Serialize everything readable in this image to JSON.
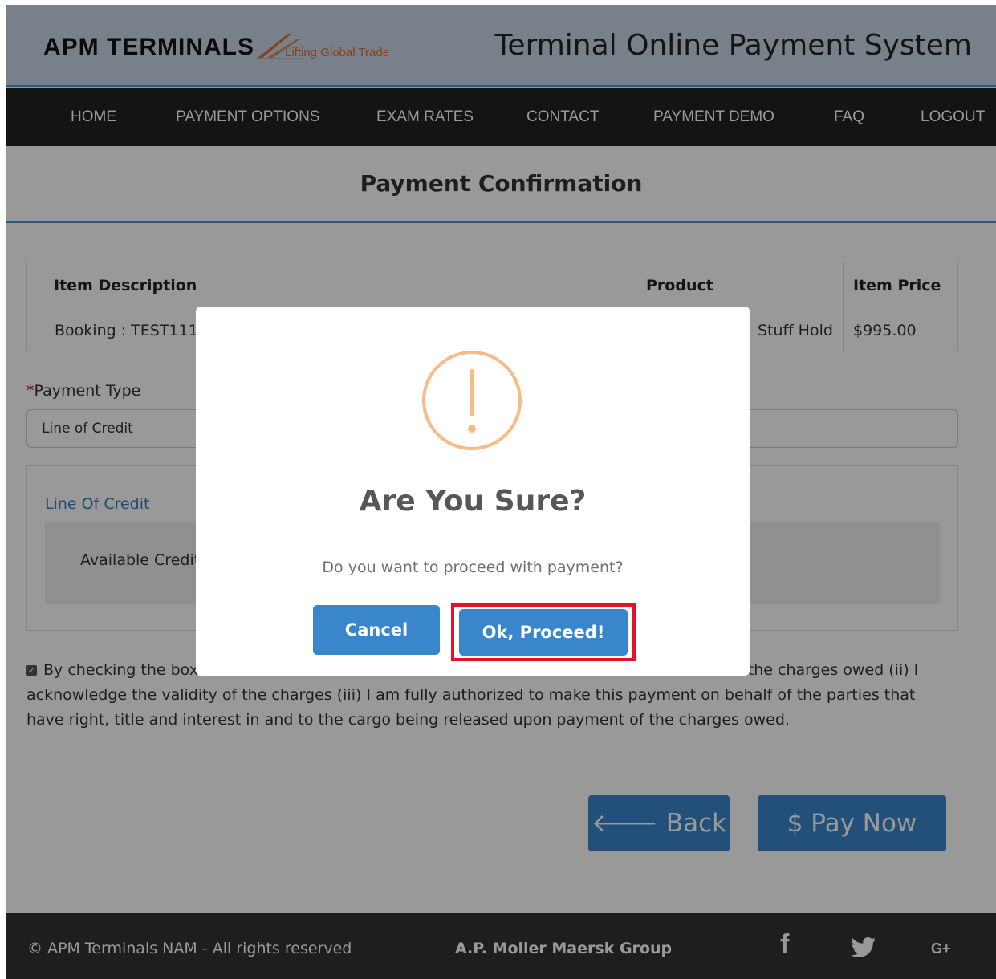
{
  "header": {
    "logo_text": "APM TERMINALS",
    "logo_tagline": "Lifting Global Trade",
    "site_title": "Terminal Online Payment System"
  },
  "nav": {
    "items": [
      "HOME",
      "PAYMENT OPTIONS",
      "EXAM RATES",
      "CONTACT",
      "PAYMENT DEMO",
      "FAQ",
      "LOGOUT"
    ]
  },
  "page": {
    "title": "Payment Confirmation"
  },
  "table": {
    "headers": [
      "Item Description",
      "Product",
      "Item Price"
    ],
    "rows": [
      {
        "description": "Booking : TEST111",
        "product": "Stuff Hold",
        "price": "$995.00"
      }
    ]
  },
  "payment": {
    "label": "Payment Type",
    "required_mark": "*",
    "selected": "Line of Credit"
  },
  "credit": {
    "title": "Line Of Credit",
    "available_label": "Available Credit"
  },
  "terms": {
    "checked": true,
    "text_part1": "By checking the box,",
    "text_part2": "d amount of the charges owed (ii) I acknowledge the validity of the charges (iii) I am fully authorized to make this payment on behalf of the parties that have right, title and interest in and to the cargo being released upon payment of the charges owed."
  },
  "buttons": {
    "back": "Back",
    "pay_now": "Pay Now"
  },
  "footer": {
    "copyright": "© APM Terminals NAM - All rights reserved",
    "group": "A.P. Moller Maersk Group"
  },
  "modal": {
    "title": "Are You Sure?",
    "text": "Do you want to proceed with payment?",
    "cancel_label": "Cancel",
    "ok_label": "Ok, Proceed!"
  },
  "colors": {
    "accent": "#3a86cc",
    "header_bg": "#c8d8e6",
    "nav_bg": "#222222",
    "warning": "#f8bb86",
    "highlight": "#e0132a"
  }
}
